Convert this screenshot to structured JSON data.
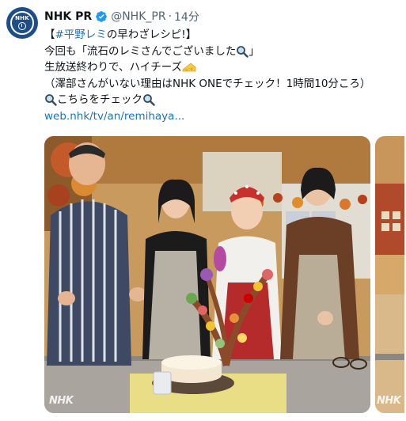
{
  "account": {
    "display_name": "NHK PR",
    "handle": "@NHK_PR",
    "separator": "·",
    "time": "14分",
    "avatar_logo_text": "NHK",
    "verified": true
  },
  "tweet": {
    "line1_open": "【",
    "line1_hashtag": "#平野レミ",
    "line1_rest": " の早わざレシピ!】",
    "line2_text": "今回も「流石のレミさんでございました",
    "line2_close": "」",
    "line3_text": "生放送終わりで、ハイチーズ",
    "line4_text": "（澤部さんがいない理由はNHK ONEでチェック！1時間10分ころ）",
    "line5_text": "こちらをチェック",
    "link_text": "web.nhk/tv/an/remihaya..."
  },
  "media": {
    "watermark_main": "NHK",
    "watermark_side": "NHK"
  },
  "icons": {
    "verified": "verified-badge-icon",
    "magnifier": "magnifying-glass-emoji-icon",
    "cheese": "cheese-emoji-icon"
  },
  "colors": {
    "link": "#1d74b9",
    "verified": "#1d9bf0",
    "muted": "#536471"
  }
}
